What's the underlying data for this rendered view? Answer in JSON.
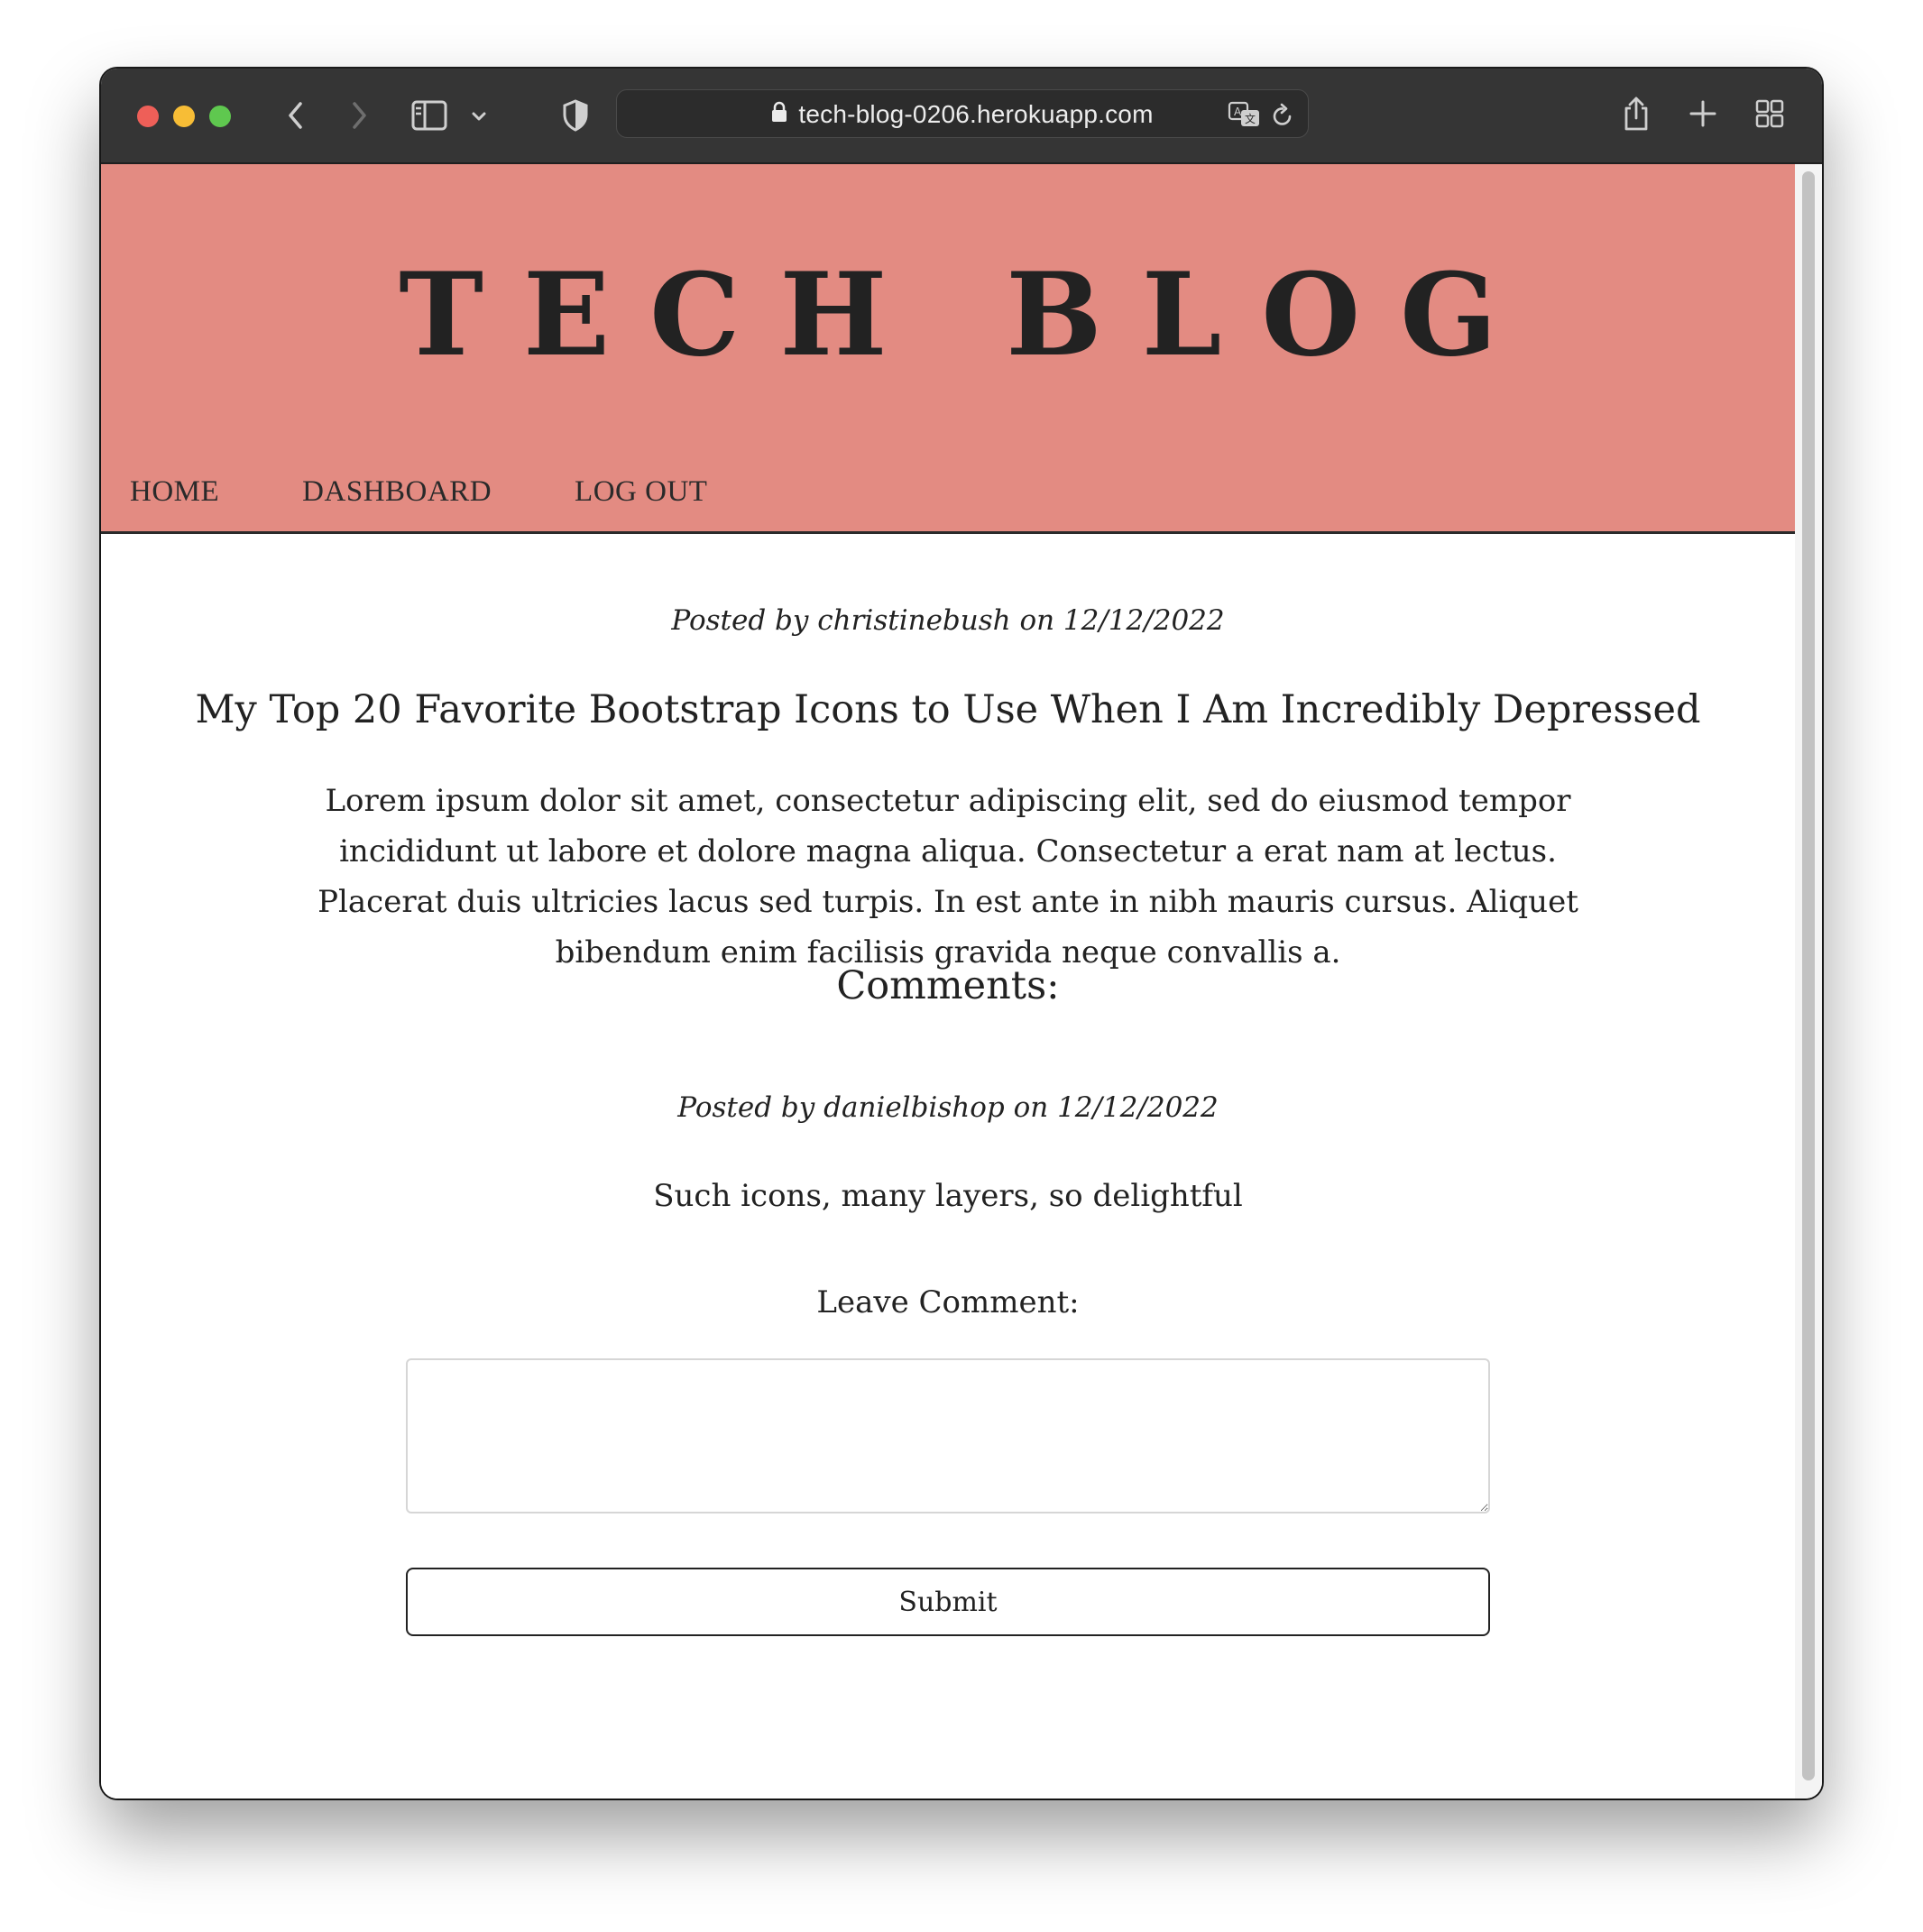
{
  "browser": {
    "url": "tech-blog-0206.herokuapp.com",
    "icons": {
      "back": "chevron-left-icon",
      "forward": "chevron-right-icon",
      "sidebar": "sidebar-icon",
      "sidebar_menu": "chevron-down-icon",
      "privacy": "shield-icon",
      "lock": "lock-icon",
      "translate": "translate-icon",
      "reload": "reload-icon",
      "share": "share-icon",
      "new_tab": "plus-icon",
      "tab_overview": "grid-icon"
    }
  },
  "site": {
    "title": "TECH BLOG",
    "header_color": "#e38b82",
    "nav": {
      "home": "HOME",
      "dashboard": "DASHBOARD",
      "logout": "LOG OUT"
    }
  },
  "post": {
    "posted_by": "Posted by christinebush on 12/12/2022",
    "title": "My Top 20 Favorite Bootstrap Icons to Use When I Am Incredibly Depressed",
    "body": "Lorem ipsum dolor sit amet, consectetur adipiscing elit, sed do eiusmod tempor incididunt ut labore et dolore magna aliqua. Consectetur a erat nam at lectus. Placerat duis ultricies lacus sed turpis. In est ante in nibh mauris cursus. Aliquet bibendum enim facilisis gravida neque convallis a."
  },
  "comments": {
    "heading": "Comments:",
    "items": [
      {
        "posted_by": "Posted by danielbishop on 12/12/2022",
        "text": "Such icons, many layers, so delightful"
      }
    ]
  },
  "comment_form": {
    "label": "Leave Comment:",
    "value": "",
    "submit_label": "Submit"
  }
}
